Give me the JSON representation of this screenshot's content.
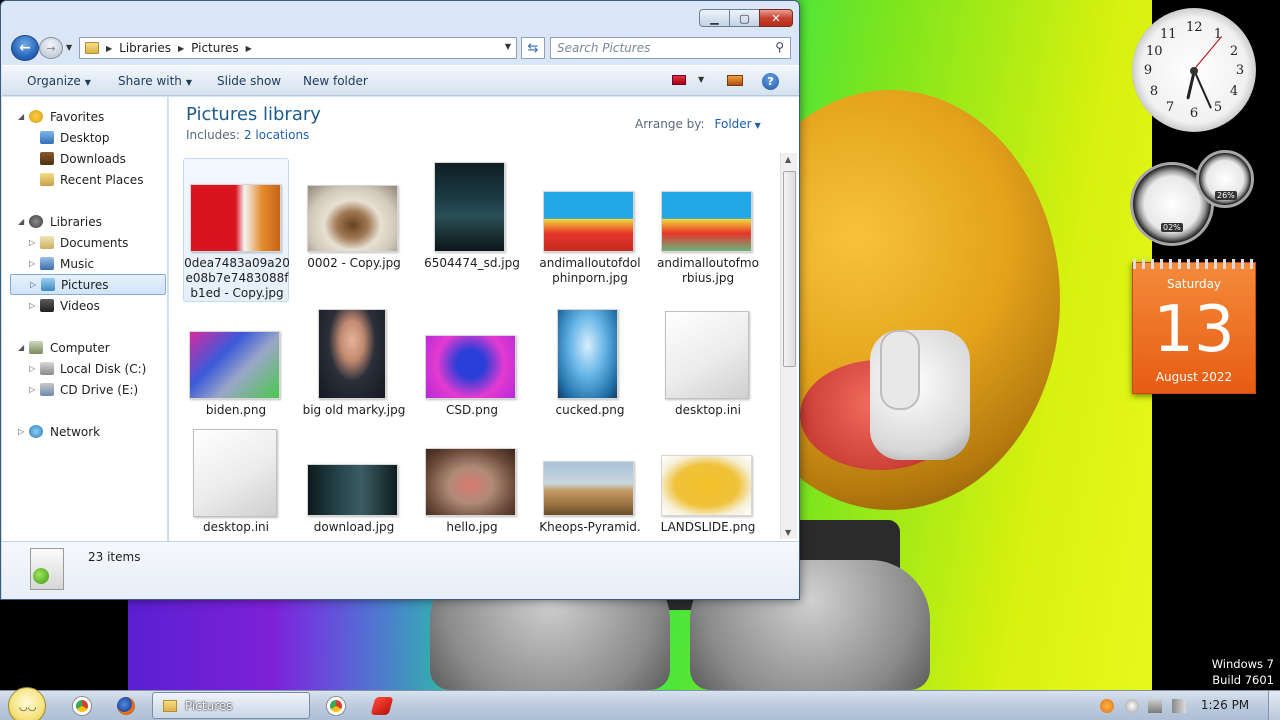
{
  "window": {
    "address": {
      "crumbs": [
        "Libraries",
        "Pictures"
      ]
    },
    "search_placeholder": "Search Pictures",
    "toolbar": {
      "organize": "Organize",
      "share_with": "Share with",
      "slide_show": "Slide show",
      "new_folder": "New folder",
      "help": "?"
    },
    "nav": {
      "favorites": "Favorites",
      "desktop": "Desktop",
      "downloads": "Downloads",
      "recent_places": "Recent Places",
      "libraries": "Libraries",
      "documents": "Documents",
      "music": "Music",
      "pictures": "Pictures",
      "videos": "Videos",
      "computer": "Computer",
      "local_disk": "Local Disk (C:)",
      "cd_drive": "CD Drive (E:)",
      "network": "Network"
    },
    "library": {
      "title": "Pictures library",
      "includes_label": "Includes:",
      "locations_link": "2 locations",
      "arrange_label": "Arrange by:",
      "arrange_value": "Folder"
    },
    "files": [
      {
        "name": "0dea7483a09a20e08b7e7483088fb1ed - Copy.jpg"
      },
      {
        "name": "0002 - Copy.jpg"
      },
      {
        "name": "6504474_sd.jpg"
      },
      {
        "name": "andimalloutofdolphinporn.jpg"
      },
      {
        "name": "andimalloutofmorbius.jpg"
      },
      {
        "name": "biden.png"
      },
      {
        "name": "big old marky.jpg"
      },
      {
        "name": "CSD.png"
      },
      {
        "name": "cucked.png"
      },
      {
        "name": "desktop.ini"
      },
      {
        "name": "desktop.ini"
      },
      {
        "name": "download.jpg"
      },
      {
        "name": "hello.jpg"
      },
      {
        "name": "Kheops-Pyramid."
      },
      {
        "name": "LANDSLIDE.png"
      }
    ],
    "details": {
      "item_count": "23 items"
    }
  },
  "gadgets": {
    "clock_numbers": [
      "12",
      "1",
      "2",
      "3",
      "4",
      "5",
      "6",
      "7",
      "8",
      "9",
      "10",
      "11"
    ],
    "cpu_meter": "02%",
    "mem_meter": "26%",
    "calendar": {
      "weekday": "Saturday",
      "day": "13",
      "month_year": "August 2022"
    }
  },
  "desktop": {
    "watermark_line1": "Windows 7",
    "watermark_line2": "Build 7601"
  },
  "taskbar": {
    "active_task": "Pictures",
    "time": "1:26 PM"
  },
  "colors": {
    "title_blue": "#1e5c8c",
    "link_blue": "#1f5fb4",
    "calendar_orange": "#e65c12"
  }
}
